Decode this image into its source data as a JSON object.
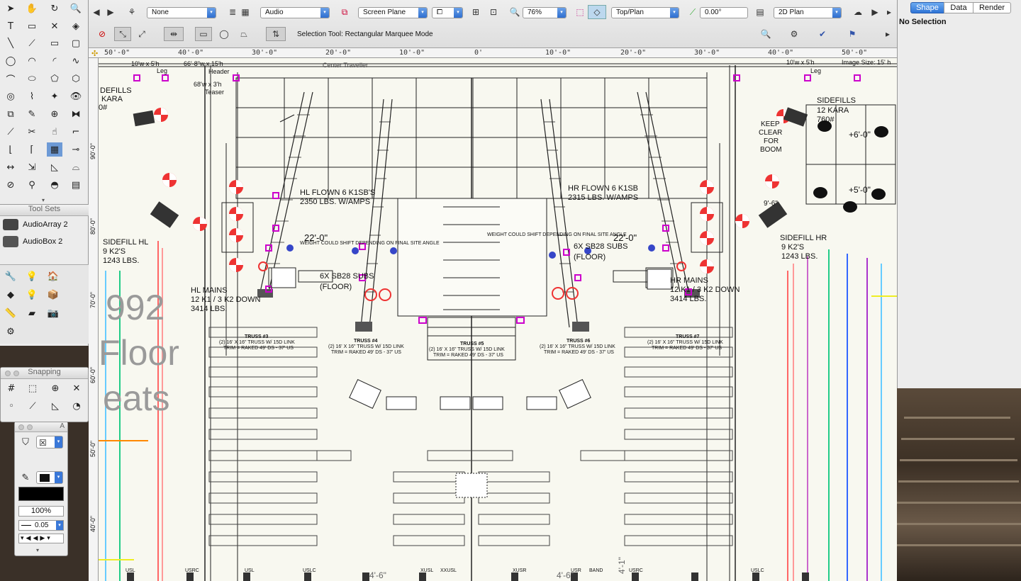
{
  "toolbar": {
    "class_dropdown": "None",
    "layer_dropdown": "Audio",
    "plane_dropdown": "Screen Plane",
    "zoom_dropdown": "76%",
    "view_dropdown": "Top/Plan",
    "rotation_field": "0.00°",
    "render_dropdown": "2D Plan",
    "mode_status": "Selection Tool: Rectangular Marquee Mode"
  },
  "ruler": {
    "ticks": [
      "50'-0\"",
      "40'-0\"",
      "30'-0\"",
      "20'-0\"",
      "10'-0\"",
      "0'",
      "10'-0\"",
      "20'-0\"",
      "30'-0\"",
      "40'-0\"",
      "50'-0\""
    ],
    "vticks": [
      "90'-0\"",
      "80'-0\"",
      "70'-0\"",
      "60'-0\"",
      "50'-0\"",
      "40'-0\""
    ]
  },
  "tool_sets": {
    "title": "Tool Sets",
    "items": [
      {
        "label": "AudioArray 2"
      },
      {
        "label": "AudioBox 2"
      }
    ]
  },
  "snapping": {
    "title": "Snapping"
  },
  "attributes": {
    "title": "A",
    "opacity": "100%",
    "line_weight": "0.05"
  },
  "oip": {
    "tabs": [
      "Shape",
      "Data",
      "Render"
    ],
    "active_tab": "Shape",
    "selection": "No Selection"
  },
  "drawing": {
    "labels": {
      "sidefills_l": "DEFILLS",
      "kara_l": "KARA",
      "zero_l": "0#",
      "header": "Header",
      "leg_l": "Leg",
      "leg_r": "Leg",
      "teaser": "Teaser",
      "center_traveller": "Center Traveller",
      "dim_top_1": "10'w x 5'h",
      "dim_top_2": "66'-8\"w x 15'h",
      "dim_top_3": "68'w x 3'h",
      "dim_top_r": "10'w x 5'h",
      "image_size": "Image Size: 15' h",
      "hl_flown": "HL FLOWN  6 K1SB'S",
      "hl_flown_w": "2350 LBS. W/AMPS",
      "hr_flown": "HR FLOWN  6 K1SB",
      "hr_flown_w": "2315 LBS. W/AMPS",
      "dim_22_l": "22'-0\"",
      "dim_22_r": "22'-0\"",
      "weight_note_l": "WEIGHT COULD SHIFT DEPENDING ON FINAL SITE ANGLE",
      "weight_note_r": "WEIGHT COULD SHIFT DEPENDING ON FINAL SITE ANGLE",
      "subs_l": "6X SB28 SUBS",
      "subs_l2": "(FLOOR)",
      "subs_r": "6X SB28 SUBS",
      "subs_r2": "(FLOOR)",
      "sidefill_hl": "SIDEFILL  HL",
      "sidefill_hl_2": "9 K2'S",
      "sidefill_hl_3": "1243  LBS.",
      "sidefill_hr": "SIDEFILL  HR",
      "sidefill_hr_2": "9 K2'S",
      "sidefill_hr_3": "1243  LBS.",
      "hl_mains": "HL MAINS",
      "hl_mains_2": "12 K1 / 3 K2 DOWN",
      "hl_mains_3": "3414 LBS.",
      "hr_mains": "HR MAINS",
      "hr_mains_2": "12 K1 / 3 K2 DOWN",
      "hr_mains_3": "3414  LBS.",
      "sidefills_r": "SIDEFILLS",
      "sidefills_r_2": "12 KARA",
      "sidefills_r_3": "760#",
      "keep_clear": "KEEP",
      "keep_clear_2": "CLEAR",
      "keep_clear_3": "FOR",
      "keep_clear_4": "BOOM",
      "dim_6": "+6'-0\"",
      "dim_5": "+5'-0\"",
      "dim_9": "9'-6\"",
      "truss3": "TRUSS #3",
      "truss4": "TRUSS #4",
      "truss5": "TRUSS #5",
      "truss6": "TRUSS #6",
      "truss7": "TRUSS #7",
      "truss_spec": "(2) 16' X 16\" TRUSS W/ 15D LINK",
      "truss_trim": "TRIM = RAKED 49' DS - 37' US",
      "seats_1": "992",
      "seats_2": "Floor",
      "seats_3": "eats",
      "bottom_1": "4'-6\"",
      "bottom_2": "4'-6\"",
      "bottom_3": "4'-1\"",
      "usl": "USL",
      "usrc": "USRC",
      "uslc": "USLC",
      "xusl": "XUSL",
      "xxusl": "XXUSL",
      "xusr": "XUSR",
      "band": "BAND",
      "usr": "USR"
    }
  }
}
